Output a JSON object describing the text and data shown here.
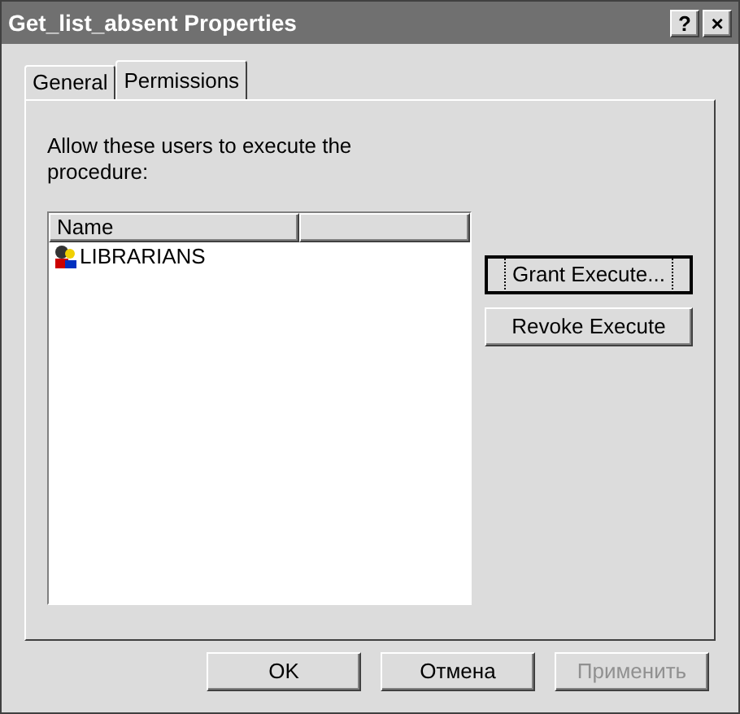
{
  "window": {
    "title": "Get_list_absent Properties",
    "title_buttons": [
      "?",
      "×"
    ]
  },
  "tabs": [
    {
      "label": "General",
      "selected": false
    },
    {
      "label": "Permissions",
      "selected": true
    }
  ],
  "permissions": {
    "prompt": "Allow these users to execute the procedure:",
    "list": {
      "columns": [
        "Name",
        ""
      ],
      "rows": [
        {
          "name": "LIBRARIANS"
        }
      ]
    },
    "buttons": [
      {
        "label": "Grant Execute...",
        "focused": true
      },
      {
        "label": "Revoke Execute",
        "focused": false
      }
    ]
  },
  "buttons": [
    {
      "label": "OK",
      "disabled": false
    },
    {
      "label": "Отмена",
      "disabled": false
    },
    {
      "label": "Применить",
      "disabled": true
    }
  ]
}
